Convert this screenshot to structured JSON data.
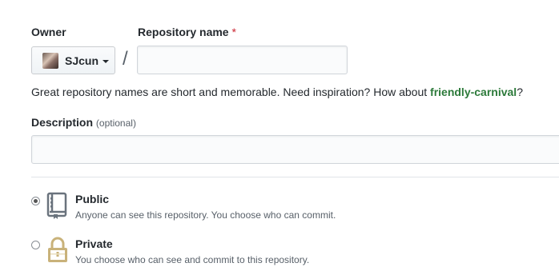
{
  "owner": {
    "label": "Owner",
    "selected": "SJcun"
  },
  "repository": {
    "label": "Repository name",
    "required_mark": "*",
    "separator": "/",
    "value": ""
  },
  "hint": {
    "text": "Great repository names are short and memorable. Need inspiration? How about ",
    "suggestion": "friendly-carnival",
    "end": "?"
  },
  "description": {
    "label": "Description",
    "optional": "(optional)",
    "value": ""
  },
  "visibility": {
    "public": {
      "title": "Public",
      "desc": "Anyone can see this repository. You choose who can commit.",
      "checked": true
    },
    "private": {
      "title": "Private",
      "desc": "You choose who can see and commit to this repository.",
      "checked": false
    }
  },
  "colors": {
    "suggestion": "#2c7a3a",
    "required": "#cb2431",
    "icon": "#6a737d",
    "lock": "#c9b27a"
  }
}
